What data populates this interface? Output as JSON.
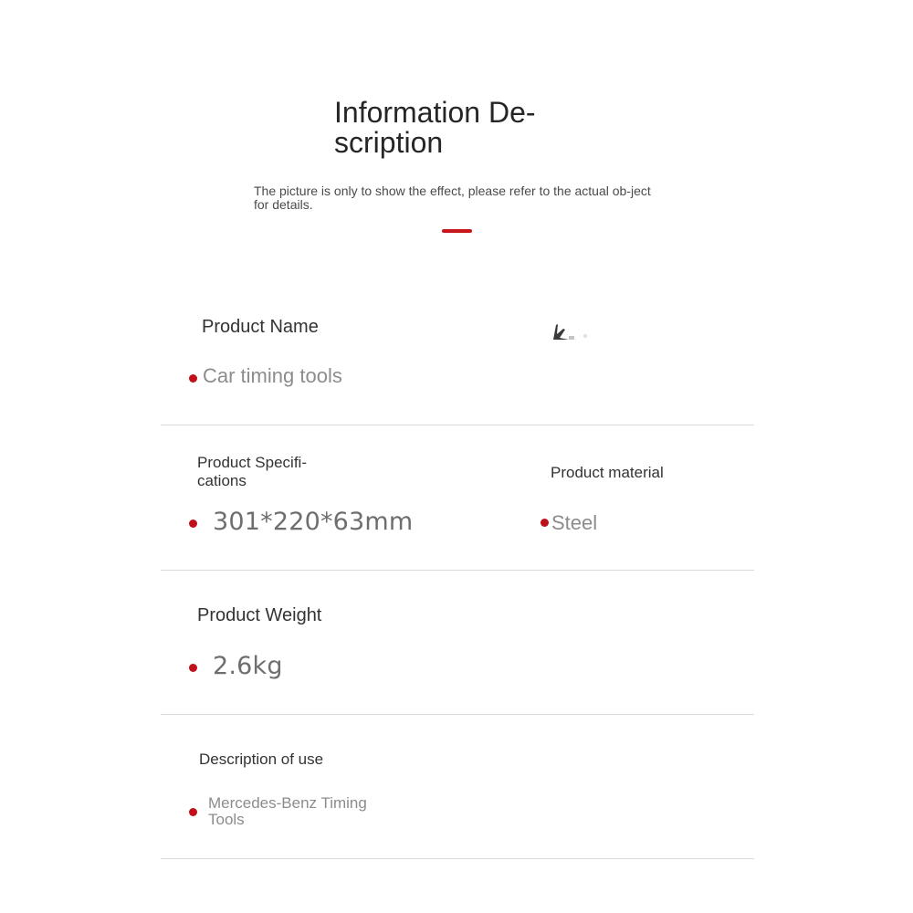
{
  "header": {
    "title": "Information De-scription",
    "subtitle": "The picture is only to show the effect, please refer to the actual ob-ject for details."
  },
  "colors": {
    "accent": "#c8161d",
    "bullet": "#c0101a",
    "divider": "#d9d9d9"
  },
  "product_name": {
    "label": "Product Name",
    "value": "Car timing tools"
  },
  "specifications": {
    "label": "Product Specifi-cations",
    "value": "301*220*63mm"
  },
  "material": {
    "label": "Product material",
    "value": "Steel"
  },
  "weight": {
    "label": "Product Weight",
    "value": "2.6kg"
  },
  "description": {
    "label": "Description of use",
    "value": "Mercedes-Benz Timing Tools"
  }
}
